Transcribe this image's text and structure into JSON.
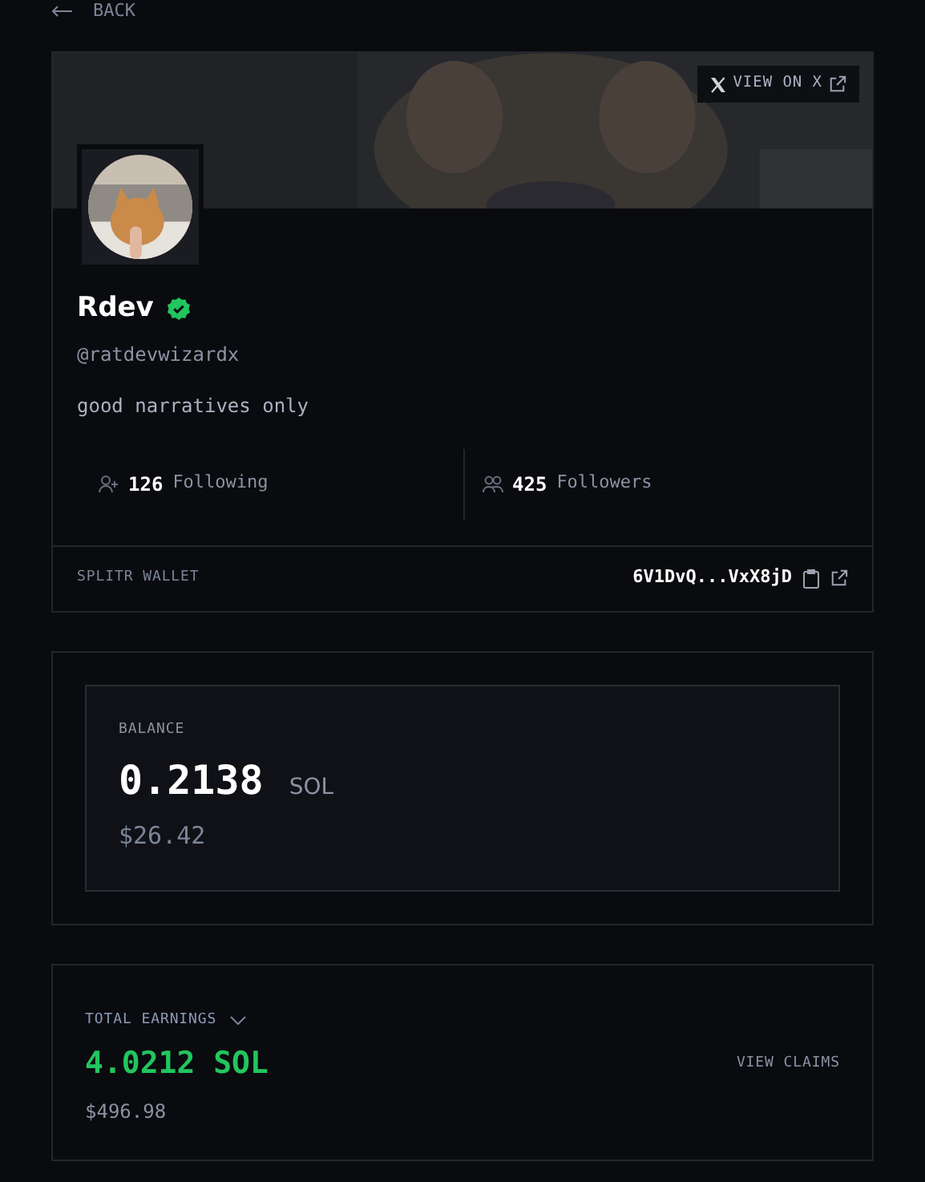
{
  "back_link": {
    "label": "BACK"
  },
  "profile": {
    "view_on_x": "VIEW ON X",
    "name": "Rdev",
    "verified": true,
    "handle": "@ratdevwizardx",
    "bio": "good narratives only",
    "stats": [
      {
        "kind": "following",
        "count": "126",
        "label": "Following"
      },
      {
        "kind": "followers",
        "count": "425",
        "label": "Followers"
      }
    ],
    "wallet": {
      "label": "SPLITR WALLET",
      "address": "6V1DvQ...VxX8jD"
    }
  },
  "balance": {
    "label": "BALANCE",
    "amount": "0.2138",
    "unit": "SOL",
    "usd": "$26.42"
  },
  "earnings": {
    "label": "TOTAL EARNINGS",
    "expanded": false,
    "amount": "4.0212 SOL",
    "usd": "$496.98",
    "action": "VIEW CLAIMS"
  }
}
